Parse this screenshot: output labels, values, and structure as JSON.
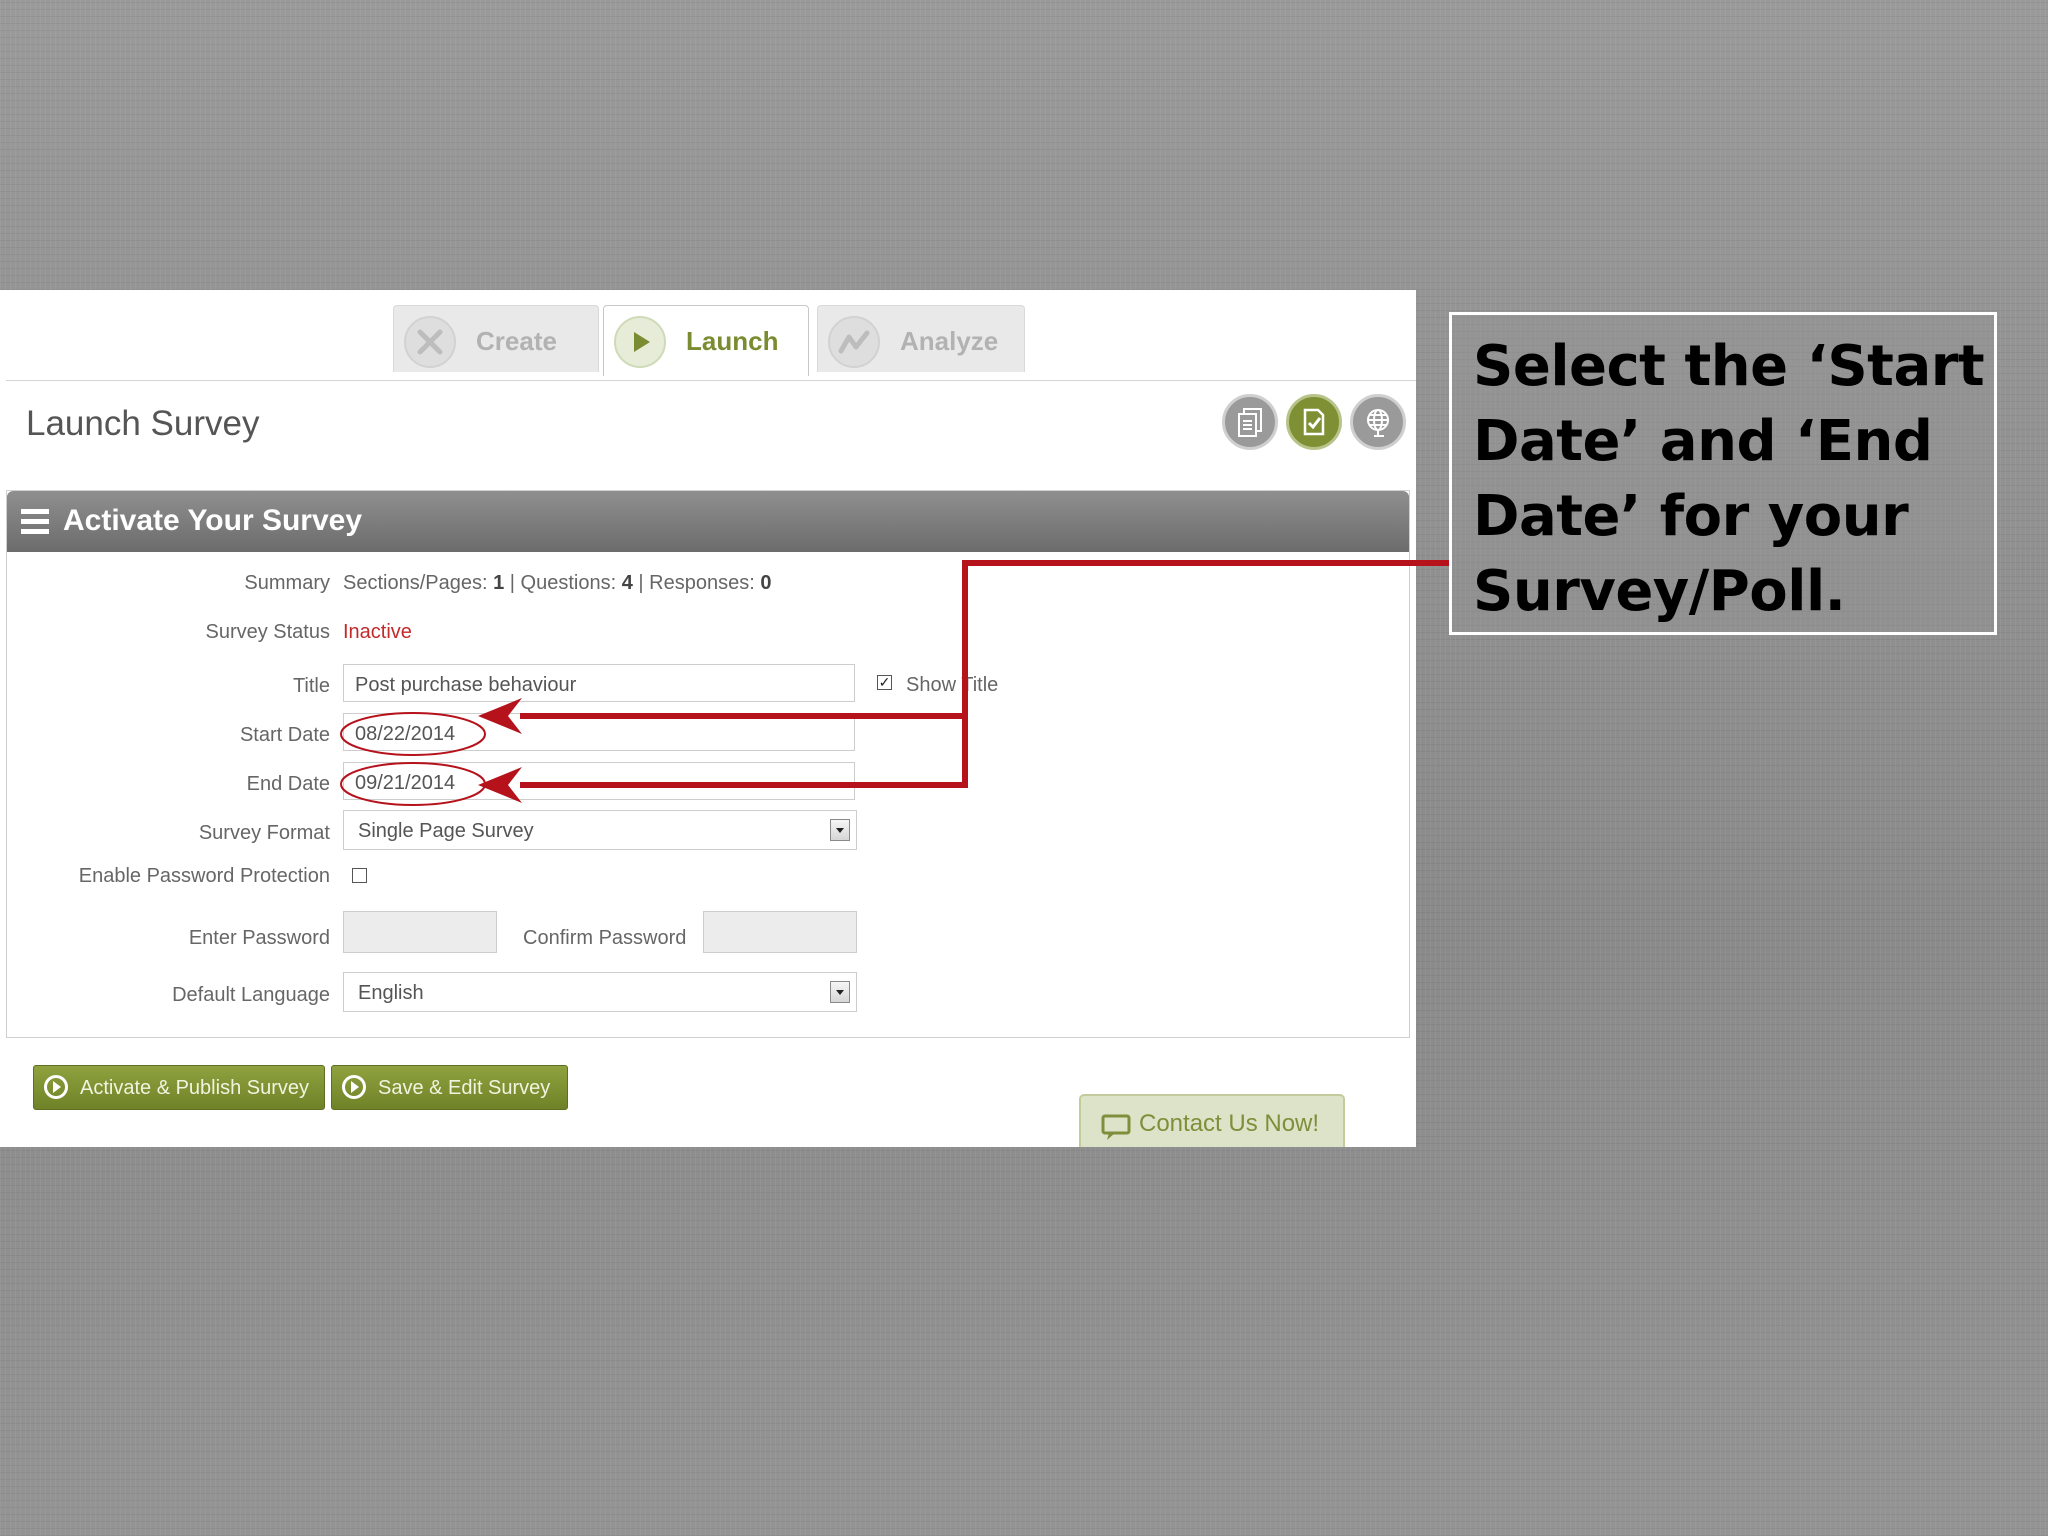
{
  "tabs": [
    {
      "label": "Create",
      "active": false
    },
    {
      "label": "Launch",
      "active": true
    },
    {
      "label": "Analyze",
      "active": false
    }
  ],
  "page_title": "Launch Survey",
  "panel": {
    "title": "Activate Your Survey",
    "summary": {
      "label": "Summary",
      "sections_label": "Sections/Pages:",
      "sections_value": "1",
      "questions_label": "Questions:",
      "questions_value": "4",
      "responses_label": "Responses:",
      "responses_value": "0"
    },
    "status": {
      "label": "Survey Status",
      "value": "Inactive"
    },
    "title_field": {
      "label": "Title",
      "value": "Post purchase behaviour",
      "show_title_label": "Show Title",
      "show_title_checked": true
    },
    "start_date": {
      "label": "Start Date",
      "value": "08/22/2014"
    },
    "end_date": {
      "label": "End Date",
      "value": "09/21/2014"
    },
    "survey_format": {
      "label": "Survey Format",
      "value": "Single Page Survey"
    },
    "password_protection": {
      "label": "Enable Password Protection",
      "checked": false
    },
    "enter_password": {
      "label": "Enter Password",
      "value": ""
    },
    "confirm_password": {
      "label": "Confirm Password",
      "value": ""
    },
    "default_language": {
      "label": "Default Language",
      "value": "English"
    }
  },
  "buttons": {
    "activate_publish": "Activate & Publish Survey",
    "save_edit": "Save & Edit Survey"
  },
  "contact": "Contact Us Now!",
  "callout_text": "Select the ‘Start Date’ and ‘End Date’ for your Survey/Poll.",
  "colors": {
    "brand_green": "#7a8c31",
    "status_red": "#c22a2a",
    "annotation_red": "#b5121b"
  }
}
